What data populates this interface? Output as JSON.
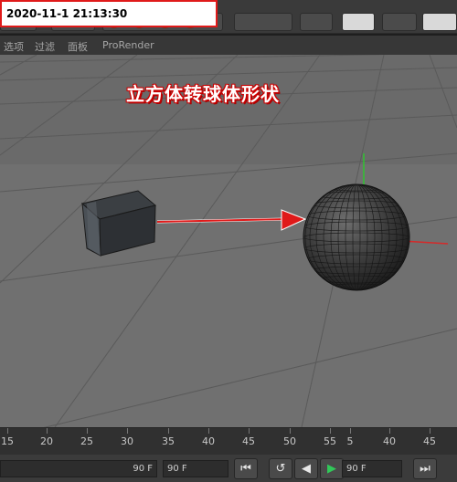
{
  "timestamp": "2020-11-1 21:13:30",
  "menu": {
    "items": [
      "选项",
      "过滤",
      "面板",
      "ProRender"
    ]
  },
  "annotation": {
    "caption": "立方体转球体形状"
  },
  "timeline": {
    "ticks": [
      "15",
      "20",
      "25",
      "30",
      "35",
      "40",
      "45",
      "50",
      "55",
      "5",
      "40",
      "45"
    ]
  },
  "transport": {
    "start_frame_field": "90 F",
    "end_frame_field": "90 F",
    "range_field": "90 F"
  },
  "colors": {
    "timestamp_border": "#e01a1a",
    "arrow": "#e01a1a",
    "axis_y": "#2fc22f",
    "axis_x": "#d42a2a",
    "viewport_bg": "#6e6e6e"
  },
  "icons": {
    "first_frame": "skip-to-start-icon",
    "prev_key": "step-back-icon",
    "play_reverse": "play-reverse-icon",
    "play_forward": "play-icon",
    "last_frame": "skip-to-end-icon"
  }
}
